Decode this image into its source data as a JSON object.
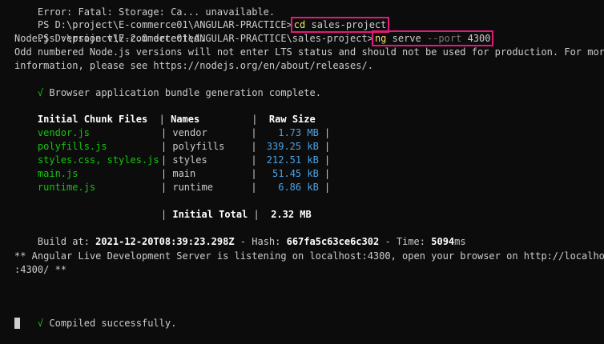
{
  "terminal": {
    "top_cut_line": "Error: Fatal: Storage: Ca... unavailable.",
    "prompt1": "PS D:\\project\\E-commerce01\\ANGULAR-PRACTICE>",
    "cmd1_part1": "cd",
    "cmd1_part2": "sales-project",
    "prompt2": "PS D:\\project\\E-commerce01\\ANGULAR-PRACTICE\\sales-project>",
    "cmd2_ng": "ng",
    "cmd2_serve": "serve",
    "cmd2_port_flag": "--port",
    "cmd2_port_val": "4300",
    "node_version": "Node.js version v17.2.0 detected.",
    "odd_line1": "Odd numbered Node.js versions will not enter LTS status and should not be used for production. For more",
    "odd_line2": "information, please see https://nodejs.org/en/about/releases/.",
    "check_mark": "√",
    "bundle_complete": "Browser application bundle generation complete.",
    "table": {
      "headers": [
        "Initial Chunk Files",
        "Names",
        "Raw Size"
      ],
      "rows": [
        {
          "file": "vendor.js",
          "name": "vendor",
          "size": "1.73 MB"
        },
        {
          "file": "polyfills.js",
          "name": "polyfills",
          "size": "339.25 kB"
        },
        {
          "file": "styles.css, styles.js",
          "name": "styles",
          "size": "212.51 kB"
        },
        {
          "file": "main.js",
          "name": "main",
          "size": "51.45 kB"
        },
        {
          "file": "runtime.js",
          "name": "runtime",
          "size": "6.86 kB"
        }
      ],
      "total_label": "Initial Total",
      "total_size": "2.32 MB"
    },
    "build_prefix": "Build at:",
    "build_date": "2021-12-20T08:39:23.298Z",
    "hash_prefix": "- Hash:",
    "hash": "667fa5c63ce6c302",
    "time_prefix": "- Time:",
    "time_value": "5094",
    "time_unit": "ms",
    "server_line1": "** Angular Live Development Server is listening on localhost:4300, open your browser on http://localhost",
    "server_line2": ":4300/ **",
    "compiled": "Compiled successfully."
  }
}
